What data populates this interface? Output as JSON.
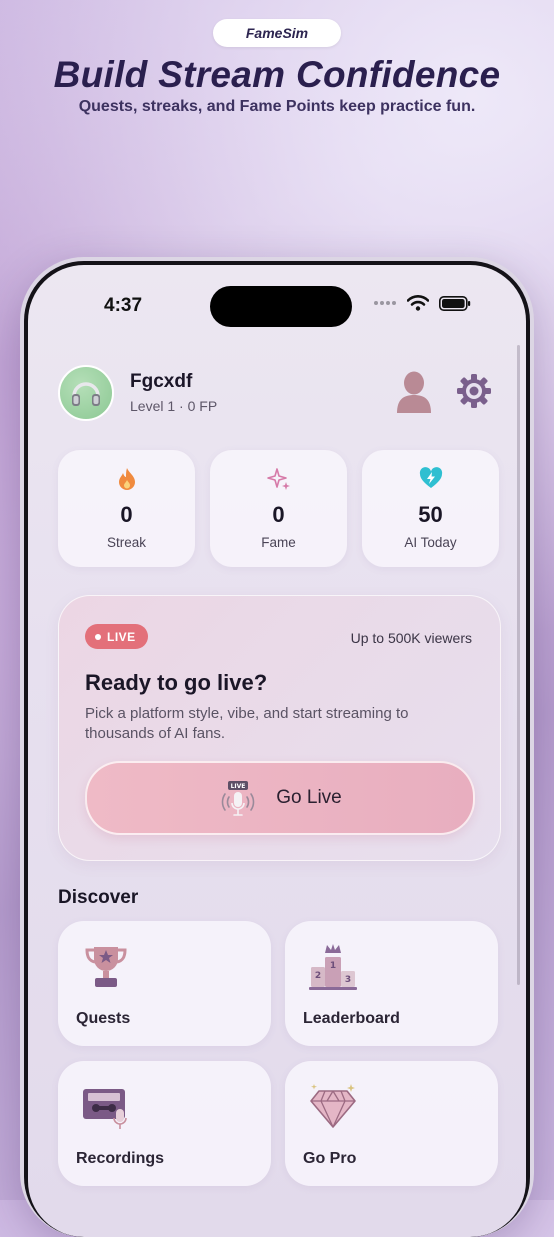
{
  "promo": {
    "badge": "FameSim",
    "title": "Build Stream Confidence",
    "subtitle": "Quests, streaks, and Fame Points keep practice fun."
  },
  "status_bar": {
    "time": "4:37"
  },
  "profile": {
    "name": "Fgcxdf",
    "level": "Level 1 · 0 FP"
  },
  "stats": [
    {
      "value": "0",
      "label": "Streak",
      "icon": "fire-icon",
      "color": "#f08a3e"
    },
    {
      "value": "0",
      "label": "Fame",
      "icon": "sparkles-icon",
      "color": "#d67aa8"
    },
    {
      "value": "50",
      "label": "AI Today",
      "icon": "lightning-heart-icon",
      "color": "#2fbfd1"
    }
  ],
  "live": {
    "badge": "LIVE",
    "viewers": "Up to 500K viewers",
    "title": "Ready to go live?",
    "description": "Pick a platform style, vibe, and start streaming to thousands of AI fans.",
    "button_label": "Go Live",
    "mic_badge": "LIVE"
  },
  "discover": {
    "title": "Discover",
    "items": [
      {
        "label": "Quests",
        "icon": "trophy-icon"
      },
      {
        "label": "Leaderboard",
        "icon": "podium-icon",
        "podium": [
          "2",
          "1",
          "3"
        ]
      },
      {
        "label": "Recordings",
        "icon": "cassette-icon"
      },
      {
        "label": "Go Pro",
        "icon": "diamond-icon"
      }
    ]
  },
  "colors": {
    "live_badge": "#e3707a",
    "go_live_button": "#e8aebf",
    "accent_purple": "#7a5f8c"
  }
}
